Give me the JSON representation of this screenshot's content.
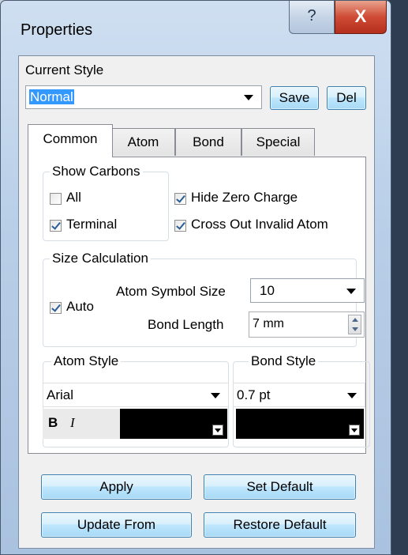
{
  "window": {
    "title": "Properties",
    "help_label": "?",
    "close_label": "X"
  },
  "current_style": {
    "label": "Current Style",
    "value": "Normal",
    "save_label": "Save",
    "del_label": "Del"
  },
  "tabs": [
    {
      "label": "Common",
      "active": true
    },
    {
      "label": "Atom",
      "active": false
    },
    {
      "label": "Bond",
      "active": false
    },
    {
      "label": "Special",
      "active": false
    }
  ],
  "show_carbons": {
    "label": "Show Carbons",
    "all": {
      "label": "All",
      "checked": false
    },
    "terminal": {
      "label": "Terminal",
      "checked": true
    }
  },
  "hide_zero_charge": {
    "label": "Hide Zero Charge",
    "checked": true
  },
  "cross_out_invalid": {
    "label": "Cross Out Invalid Atom",
    "checked": true
  },
  "size_calculation": {
    "label": "Size Calculation",
    "auto": {
      "label": "Auto",
      "checked": true
    },
    "atom_symbol_size_label": "Atom Symbol Size",
    "atom_symbol_size_value": "10",
    "bond_length_label": "Bond Length",
    "bond_length_value": "7 mm"
  },
  "atom_style": {
    "label": "Atom Style",
    "font": "Arial",
    "bold_label": "B",
    "italic_label": "I",
    "color": "#000000"
  },
  "bond_style": {
    "label": "Bond Style",
    "width": "0.7 pt",
    "color": "#000000"
  },
  "buttons": {
    "apply": "Apply",
    "set_default": "Set Default",
    "update_from": "Update From",
    "restore_default": "Restore Default"
  }
}
